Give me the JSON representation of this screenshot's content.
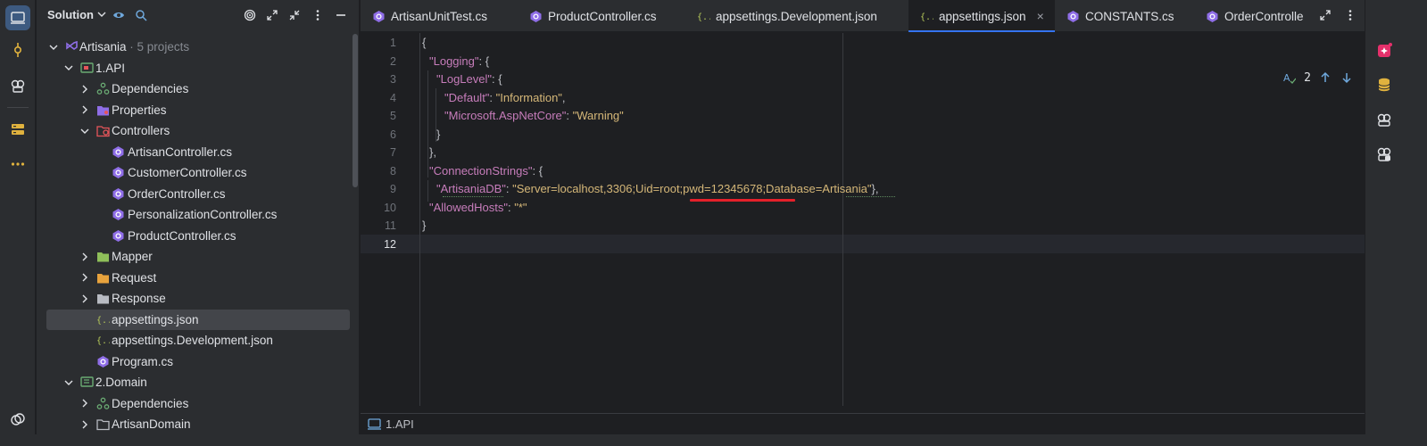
{
  "activity_bar": {
    "items": [
      {
        "icon": "project-icon",
        "active": true
      },
      {
        "icon": "commit-icon",
        "active": false
      },
      {
        "icon": "structure-icon",
        "active": false
      },
      {
        "icon": "services-icon",
        "active": false
      },
      {
        "icon": "more-icon",
        "active": false
      }
    ],
    "bottom_icon": "learn-icon"
  },
  "project_panel": {
    "title": "Solution",
    "actions": [
      "eye-icon",
      "search-icon",
      "target-icon",
      "expand-icon",
      "collapse-icon",
      "kebab-icon",
      "minimize-icon"
    ],
    "tree": [
      {
        "label": "Artisania",
        "meta": "· 5 projects",
        "level": 0,
        "expanded": true,
        "icon": "solution-icon"
      },
      {
        "label": "1.API",
        "level": 1,
        "expanded": true,
        "icon": "web-project-icon"
      },
      {
        "label": "Dependencies",
        "level": 2,
        "expanded": false,
        "icon": "dependencies-icon"
      },
      {
        "label": "Properties",
        "level": 2,
        "expanded": false,
        "icon": "properties-folder-icon"
      },
      {
        "label": "Controllers",
        "level": 2,
        "expanded": true,
        "icon": "controllers-folder-icon"
      },
      {
        "label": "ArtisanController.cs",
        "level": 3,
        "icon": "csharp-file-icon"
      },
      {
        "label": "CustomerController.cs",
        "level": 3,
        "icon": "csharp-file-icon"
      },
      {
        "label": "OrderController.cs",
        "level": 3,
        "icon": "csharp-file-icon"
      },
      {
        "label": "PersonalizationController.cs",
        "level": 3,
        "icon": "csharp-file-icon"
      },
      {
        "label": "ProductController.cs",
        "level": 3,
        "icon": "csharp-file-icon"
      },
      {
        "label": "Mapper",
        "level": 2,
        "expanded": false,
        "icon": "green-folder-icon"
      },
      {
        "label": "Request",
        "level": 2,
        "expanded": false,
        "icon": "orange-folder-icon"
      },
      {
        "label": "Response",
        "level": 2,
        "expanded": false,
        "icon": "folder-icon"
      },
      {
        "label": "appsettings.json",
        "level": 2,
        "icon": "json-file-icon",
        "selected": true
      },
      {
        "label": "appsettings.Development.json",
        "level": 2,
        "icon": "json-file-icon"
      },
      {
        "label": "Program.cs",
        "level": 2,
        "icon": "csharp-file-icon"
      },
      {
        "label": "2.Domain",
        "level": 1,
        "expanded": true,
        "icon": "library-project-icon"
      },
      {
        "label": "Dependencies",
        "level": 2,
        "expanded": false,
        "icon": "dependencies-icon"
      },
      {
        "label": "ArtisanDomain",
        "level": 2,
        "expanded": false,
        "icon": "folder-outline-icon"
      }
    ]
  },
  "editor": {
    "tabs": [
      {
        "label": "ArtisanUnitTest.cs",
        "icon": "csharp-file-icon",
        "active": false
      },
      {
        "label": "ProductController.cs",
        "icon": "csharp-file-icon",
        "active": false
      },
      {
        "label": "appsettings.Development.json",
        "icon": "json-file-icon",
        "active": false
      },
      {
        "label": "appsettings.json",
        "icon": "json-file-icon",
        "active": true,
        "close": "×"
      },
      {
        "label": "CONSTANTS.cs",
        "icon": "csharp-file-icon",
        "active": false
      },
      {
        "label": "OrderControlle",
        "icon": "csharp-file-icon",
        "active": false
      }
    ],
    "tab_actions": [
      "maximize-icon",
      "kebab-icon"
    ],
    "inspections_count": "2",
    "current_line": 12,
    "lines": [
      {
        "n": "1"
      },
      {
        "n": "2"
      },
      {
        "n": "3"
      },
      {
        "n": "4"
      },
      {
        "n": "5"
      },
      {
        "n": "6"
      },
      {
        "n": "7"
      },
      {
        "n": "8"
      },
      {
        "n": "9"
      },
      {
        "n": "10"
      },
      {
        "n": "11"
      },
      {
        "n": "12"
      }
    ],
    "code": {
      "l1": "{",
      "l2_key": "\"Logging\"",
      "l2_rest": ": {",
      "l3_key": "\"LogLevel\"",
      "l3_rest": ": {",
      "l4_key": "\"Default\"",
      "l4_colon": ": ",
      "l4_val": "\"Information\"",
      "l4_end": ",",
      "l5_key": "\"Microsoft.AspNetCore\"",
      "l5_colon": ": ",
      "l5_val": "\"Warning\"",
      "l6": "}",
      "l7": "},",
      "l8_key": "\"ConnectionStrings\"",
      "l8_rest": ": {",
      "l9_key": "\"ArtisaniaDB\"",
      "l9_colon": ": ",
      "l9_val": "\"Server=localhost,3306;Uid=root;pwd=12345678;Database=Artisania\"",
      "l9_end": "},",
      "l10_key": "\"AllowedHosts\"",
      "l10_colon": ": ",
      "l10_val": "\"*\"",
      "l11": "}",
      "l12": ""
    },
    "highlight_note": "pwd=12345678;Database"
  },
  "status_bar": {
    "breadcrumb": "1.API"
  },
  "right_bar": {
    "items": [
      "ai-assistant-icon",
      "database-icon",
      "copilot-icon",
      "copilot-chat-icon"
    ]
  },
  "colors": {
    "bg": "#1e1f22",
    "panel": "#2b2d30",
    "key": "#c77dbb",
    "string": "#d5b778",
    "accent": "#3574f0",
    "csharp": "#8f6ee7",
    "highlight_underline": "#e5202a"
  }
}
